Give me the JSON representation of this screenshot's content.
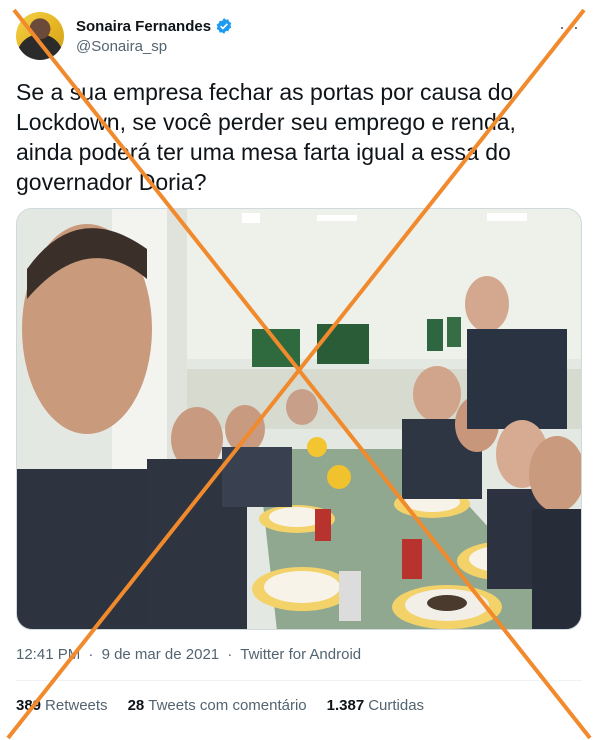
{
  "author": {
    "display_name": "Sonaira Fernandes",
    "handle": "@Sonaira_sp",
    "verified": true,
    "avatar_icon": "avatar-photo",
    "more_icon": "ellipsis-icon"
  },
  "tweet": {
    "text": "Se a sua empresa fechar as portas por causa do Lockdown, se você perder seu emprego e renda, ainda poderá ter uma mesa farta igual a essa do governador Doria?",
    "time": "12:41 PM",
    "separator": "·",
    "date": "9 de mar de 2021",
    "source": "Twitter for Android"
  },
  "stats": {
    "retweets_count": "389",
    "retweets_label": "Retweets",
    "quotes_count": "28",
    "quotes_label": "Tweets com comentário",
    "likes_count": "1.387",
    "likes_label": "Curtidas"
  },
  "colors": {
    "verified_blue": "#1d9bf0",
    "cross_orange": "#f08a2c",
    "muted_text": "#536471"
  }
}
